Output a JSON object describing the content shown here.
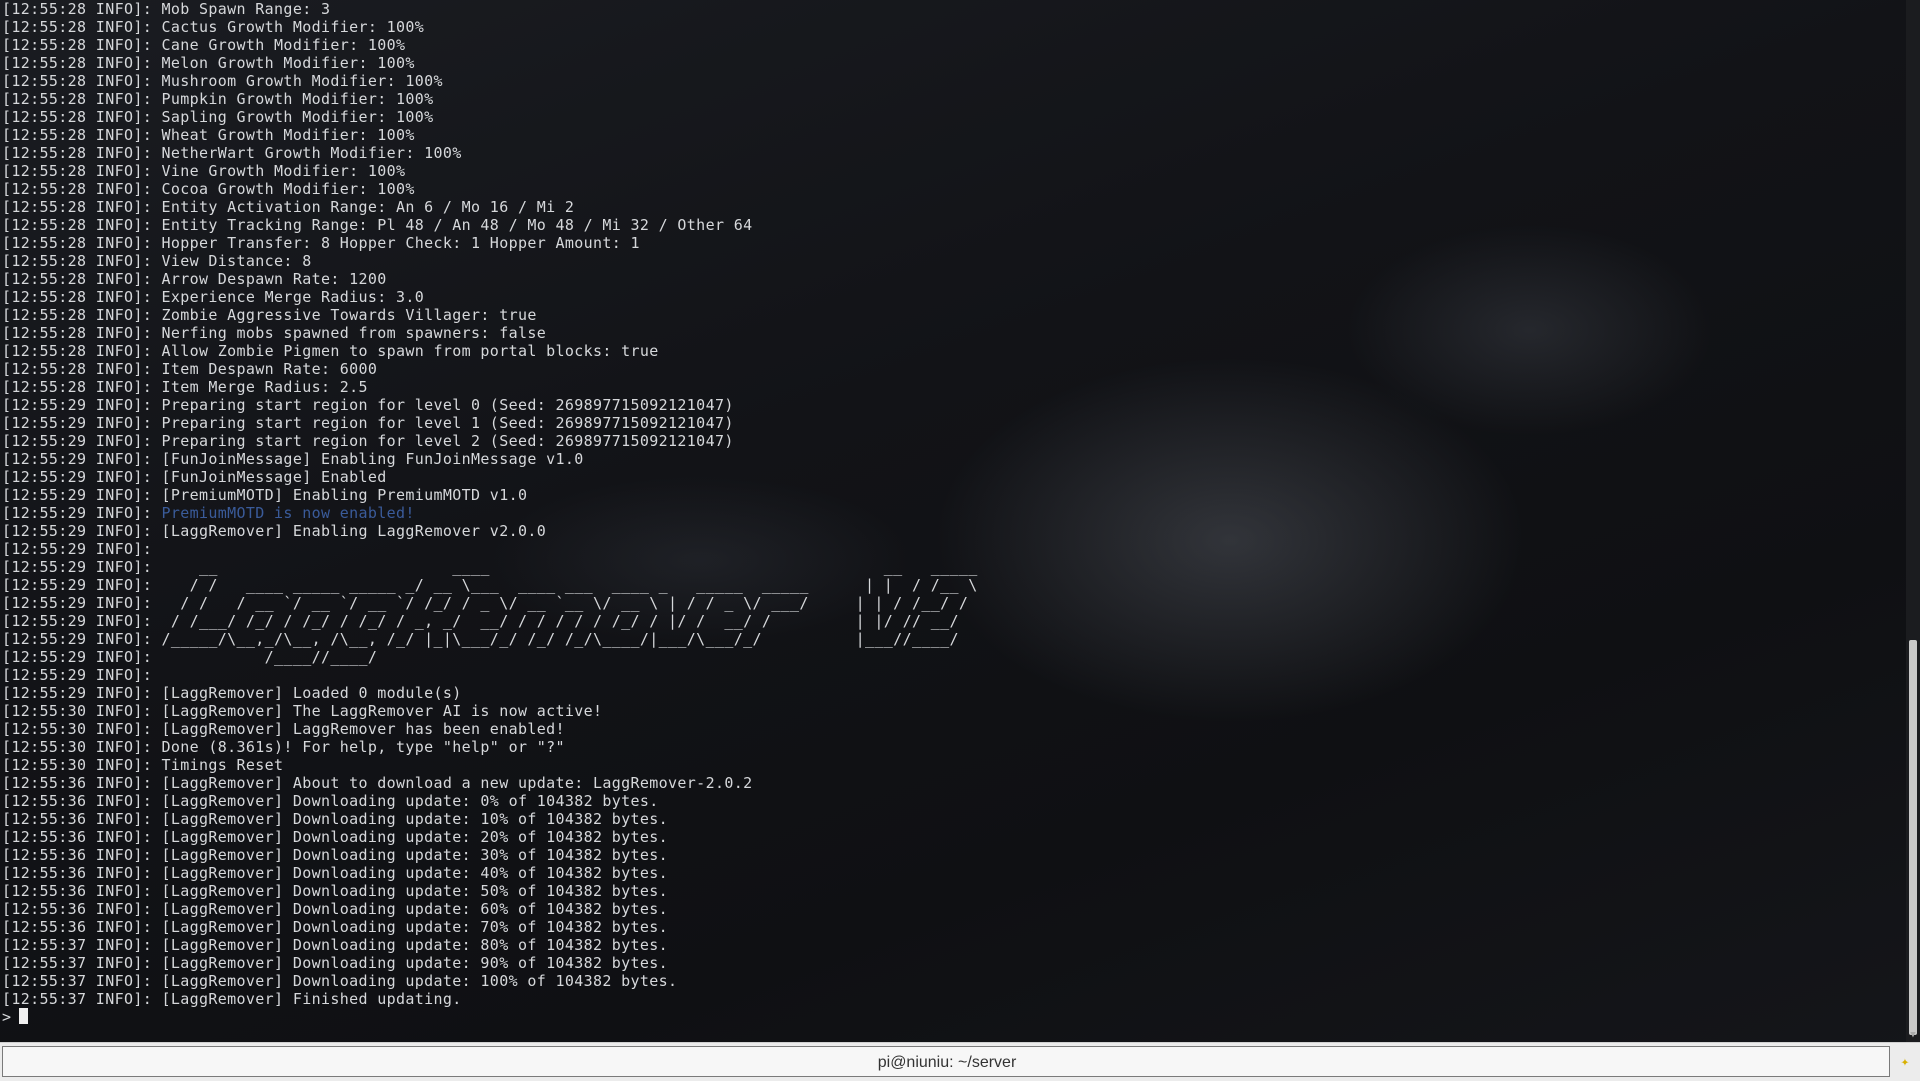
{
  "terminal": {
    "lines": [
      {
        "ts": "[12:55:28 INFO]: ",
        "msg": "Mob Spawn Range: 3"
      },
      {
        "ts": "[12:55:28 INFO]: ",
        "msg": "Cactus Growth Modifier: 100%"
      },
      {
        "ts": "[12:55:28 INFO]: ",
        "msg": "Cane Growth Modifier: 100%"
      },
      {
        "ts": "[12:55:28 INFO]: ",
        "msg": "Melon Growth Modifier: 100%"
      },
      {
        "ts": "[12:55:28 INFO]: ",
        "msg": "Mushroom Growth Modifier: 100%"
      },
      {
        "ts": "[12:55:28 INFO]: ",
        "msg": "Pumpkin Growth Modifier: 100%"
      },
      {
        "ts": "[12:55:28 INFO]: ",
        "msg": "Sapling Growth Modifier: 100%"
      },
      {
        "ts": "[12:55:28 INFO]: ",
        "msg": "Wheat Growth Modifier: 100%"
      },
      {
        "ts": "[12:55:28 INFO]: ",
        "msg": "NetherWart Growth Modifier: 100%"
      },
      {
        "ts": "[12:55:28 INFO]: ",
        "msg": "Vine Growth Modifier: 100%"
      },
      {
        "ts": "[12:55:28 INFO]: ",
        "msg": "Cocoa Growth Modifier: 100%"
      },
      {
        "ts": "[12:55:28 INFO]: ",
        "msg": "Entity Activation Range: An 6 / Mo 16 / Mi 2"
      },
      {
        "ts": "[12:55:28 INFO]: ",
        "msg": "Entity Tracking Range: Pl 48 / An 48 / Mo 48 / Mi 32 / Other 64"
      },
      {
        "ts": "[12:55:28 INFO]: ",
        "msg": "Hopper Transfer: 8 Hopper Check: 1 Hopper Amount: 1"
      },
      {
        "ts": "[12:55:28 INFO]: ",
        "msg": "View Distance: 8"
      },
      {
        "ts": "[12:55:28 INFO]: ",
        "msg": "Arrow Despawn Rate: 1200"
      },
      {
        "ts": "[12:55:28 INFO]: ",
        "msg": "Experience Merge Radius: 3.0"
      },
      {
        "ts": "[12:55:28 INFO]: ",
        "msg": "Zombie Aggressive Towards Villager: true"
      },
      {
        "ts": "[12:55:28 INFO]: ",
        "msg": "Nerfing mobs spawned from spawners: false"
      },
      {
        "ts": "[12:55:28 INFO]: ",
        "msg": "Allow Zombie Pigmen to spawn from portal blocks: true"
      },
      {
        "ts": "[12:55:28 INFO]: ",
        "msg": "Item Despawn Rate: 6000"
      },
      {
        "ts": "[12:55:28 INFO]: ",
        "msg": "Item Merge Radius: 2.5"
      },
      {
        "ts": "[12:55:29 INFO]: ",
        "msg": "Preparing start region for level 0 (Seed: 269897715092121047)"
      },
      {
        "ts": "[12:55:29 INFO]: ",
        "msg": "Preparing start region for level 1 (Seed: 269897715092121047)"
      },
      {
        "ts": "[12:55:29 INFO]: ",
        "msg": "Preparing start region for level 2 (Seed: 269897715092121047)"
      },
      {
        "ts": "[12:55:29 INFO]: ",
        "msg": "[FunJoinMessage] Enabling FunJoinMessage v1.0"
      },
      {
        "ts": "[12:55:29 INFO]: ",
        "msg": "[FunJoinMessage] Enabled"
      },
      {
        "ts": "[12:55:29 INFO]: ",
        "msg": "[PremiumMOTD] Enabling PremiumMOTD v1.0"
      },
      {
        "ts": "[12:55:29 INFO]: ",
        "msg": "PremiumMOTD is now enabled!",
        "color": "blue"
      },
      {
        "ts": "[12:55:29 INFO]: ",
        "msg": "[LaggRemover] Enabling LaggRemover v2.0.0"
      },
      {
        "ts": "[12:55:29 INFO]: ",
        "msg": ""
      },
      {
        "ts": "[12:55:29 INFO]: ",
        "msg": "    __                         ____                                          __   _____"
      },
      {
        "ts": "[12:55:29 INFO]: ",
        "msg": "   / /   ____ _____ _____ _/ __ \\___  ____ ___  ____ _   _____  _____      | |  / /__ \\"
      },
      {
        "ts": "[12:55:29 INFO]: ",
        "msg": "  / /   / __ `/ __ `/ __ `/ /_/ / _ \\/ __ `__ \\/ __ \\ | / / _ \\/ ___/     | | / /__/ /"
      },
      {
        "ts": "[12:55:29 INFO]: ",
        "msg": " / /___/ /_/ / /_/ / /_/ / _, _/  __/ / / / / / /_/ / |/ /  __/ /         | |/ // __/"
      },
      {
        "ts": "[12:55:29 INFO]: ",
        "msg": "/_____/\\__,_/\\__, /\\__, /_/ |_|\\___/_/ /_/ /_/\\____/|___/\\___/_/          |___//____/"
      },
      {
        "ts": "[12:55:29 INFO]: ",
        "msg": "           /____//____/"
      },
      {
        "ts": "[12:55:29 INFO]: ",
        "msg": ""
      },
      {
        "ts": "[12:55:29 INFO]: ",
        "msg": "[LaggRemover] Loaded 0 module(s)"
      },
      {
        "ts": "[12:55:30 INFO]: ",
        "msg": "[LaggRemover] The LaggRemover AI is now active!"
      },
      {
        "ts": "[12:55:30 INFO]: ",
        "msg": "[LaggRemover] LaggRemover has been enabled!"
      },
      {
        "ts": "[12:55:30 INFO]: ",
        "msg": "Done (8.361s)! For help, type \"help\" or \"?\""
      },
      {
        "ts": "[12:55:30 INFO]: ",
        "msg": "Timings Reset"
      },
      {
        "ts": "[12:55:36 INFO]: ",
        "msg": "[LaggRemover] About to download a new update: LaggRemover-2.0.2"
      },
      {
        "ts": "[12:55:36 INFO]: ",
        "msg": "[LaggRemover] Downloading update: 0% of 104382 bytes."
      },
      {
        "ts": "[12:55:36 INFO]: ",
        "msg": "[LaggRemover] Downloading update: 10% of 104382 bytes."
      },
      {
        "ts": "[12:55:36 INFO]: ",
        "msg": "[LaggRemover] Downloading update: 20% of 104382 bytes."
      },
      {
        "ts": "[12:55:36 INFO]: ",
        "msg": "[LaggRemover] Downloading update: 30% of 104382 bytes."
      },
      {
        "ts": "[12:55:36 INFO]: ",
        "msg": "[LaggRemover] Downloading update: 40% of 104382 bytes."
      },
      {
        "ts": "[12:55:36 INFO]: ",
        "msg": "[LaggRemover] Downloading update: 50% of 104382 bytes."
      },
      {
        "ts": "[12:55:36 INFO]: ",
        "msg": "[LaggRemover] Downloading update: 60% of 104382 bytes."
      },
      {
        "ts": "[12:55:36 INFO]: ",
        "msg": "[LaggRemover] Downloading update: 70% of 104382 bytes."
      },
      {
        "ts": "[12:55:37 INFO]: ",
        "msg": "[LaggRemover] Downloading update: 80% of 104382 bytes."
      },
      {
        "ts": "[12:55:37 INFO]: ",
        "msg": "[LaggRemover] Downloading update: 90% of 104382 bytes."
      },
      {
        "ts": "[12:55:37 INFO]: ",
        "msg": "[LaggRemover] Downloading update: 100% of 104382 bytes."
      },
      {
        "ts": "[12:55:37 INFO]: ",
        "msg": "[LaggRemover] Finished updating."
      }
    ],
    "prompt": ">",
    "colors": {
      "text": "#d6d8db",
      "blue": "#3a5b9a",
      "background": "#0d0e12"
    }
  },
  "statusbar": {
    "title": "pi@niuniu: ~/server",
    "icon": "notification-icon"
  }
}
